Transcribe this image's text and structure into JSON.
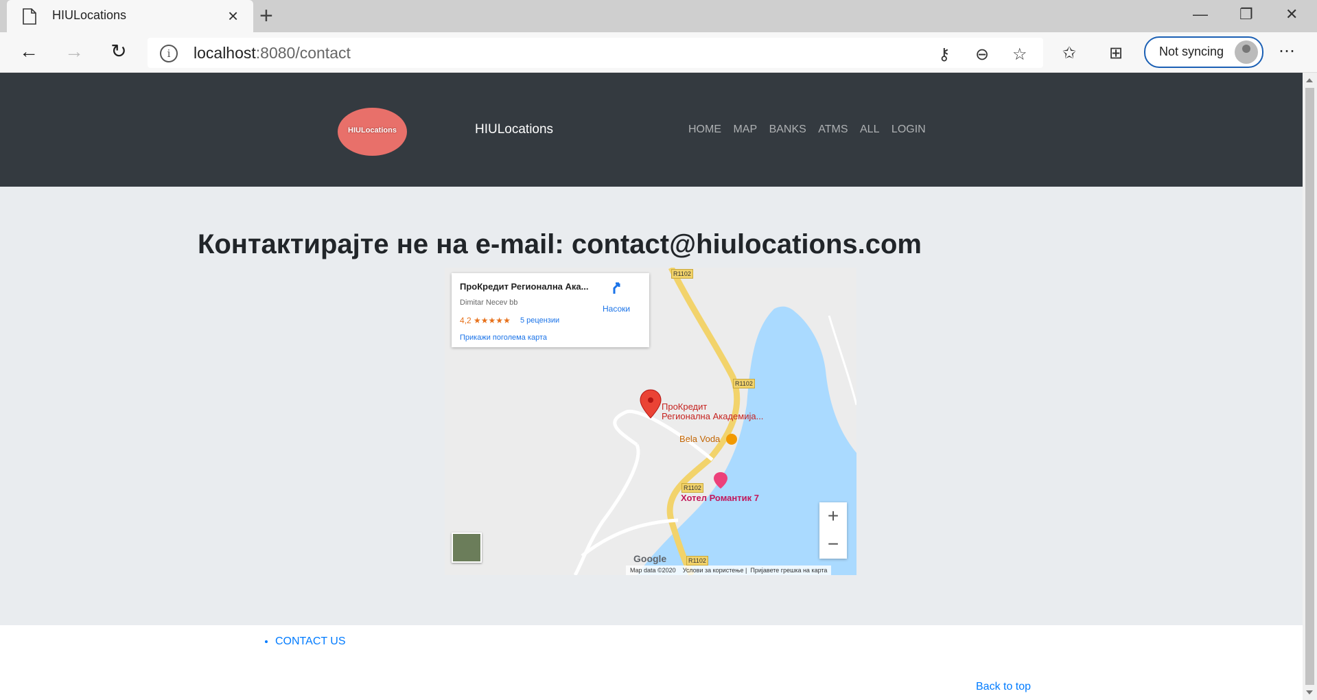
{
  "browser": {
    "tab_title": "HIULocations",
    "url_host": "localhost",
    "url_rest": ":8080/contact",
    "sync_label": "Not syncing"
  },
  "site": {
    "logo_text": "HIULocations",
    "brand": "HIULocations",
    "nav": [
      "HOME",
      "MAP",
      "BANKS",
      "ATMS",
      "ALL",
      "LOGIN"
    ]
  },
  "contact": {
    "heading": "Контактирајте не на e-mail: contact@hiulocations.com"
  },
  "map": {
    "place_name": "ПроКредит Регионална Ака...",
    "address": "Dimitar Necev bb",
    "rating": "4,2",
    "stars": "★★★★★",
    "reviews": "5 рецензии",
    "larger_map": "Прикажи поголема карта",
    "directions": "Насоки",
    "marker_label_1": "ПроКредит",
    "marker_label_2": "Регионална Академија...",
    "poi_bela_voda": "Bela Voda",
    "poi_hotel": "Хотел Романтик 7",
    "road_label": "R1102",
    "zoom_in": "+",
    "zoom_out": "−",
    "google": "Google",
    "map_data": "Map data ©2020",
    "terms": "Услови за користење",
    "report": "Пријавете грешка на карта",
    "colors": {
      "water": "#aadaff",
      "road": "#fde293",
      "marker": "#ea4335"
    }
  },
  "footer": {
    "contact_us": "CONTACT US",
    "back_to_top": "Back to top"
  }
}
